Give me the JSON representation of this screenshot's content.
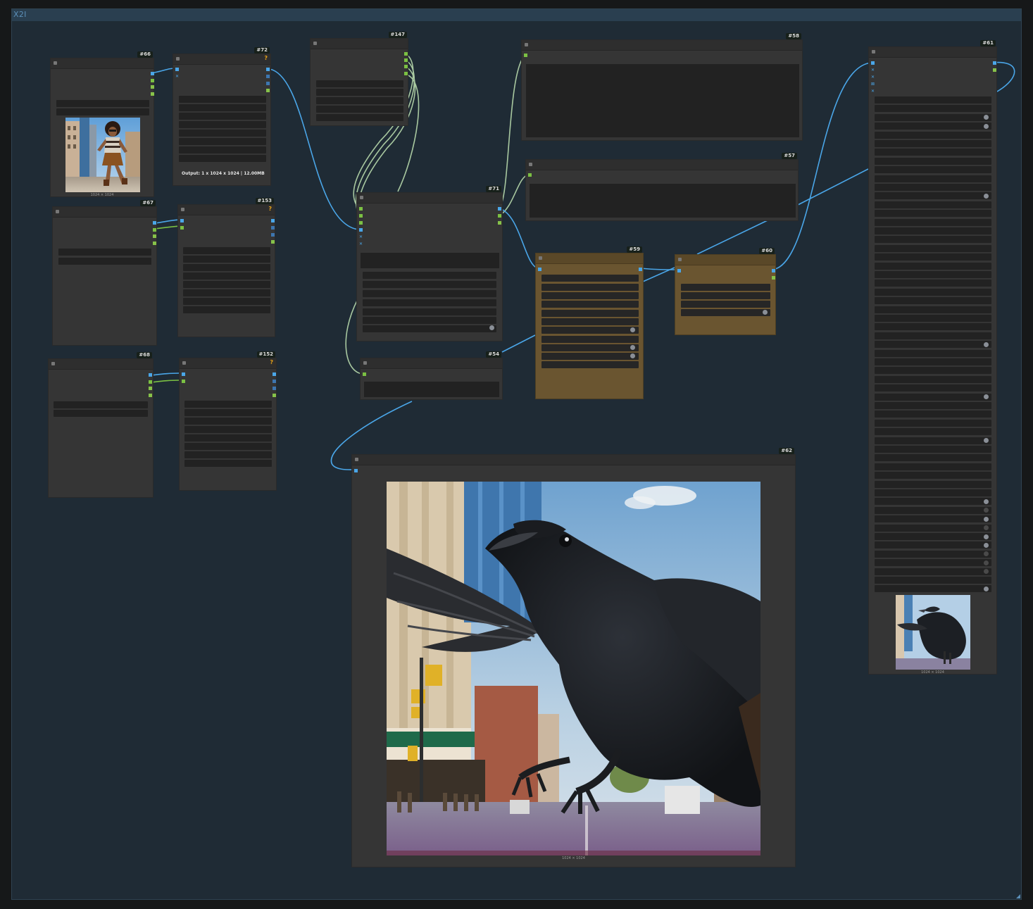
{
  "group": {
    "title": "X2I"
  },
  "nodes": {
    "n66": {
      "id": "#66",
      "image_size": "1024 × 1024"
    },
    "n72": {
      "id": "#72",
      "warning": "?",
      "output_text": "Output: 1 x 1024 x 1024 | 12.00MB"
    },
    "n147": {
      "id": "#147"
    },
    "n58": {
      "id": "#58"
    },
    "n57": {
      "id": "#57"
    },
    "n61": {
      "id": "#61",
      "image_size": "1024 × 1024"
    },
    "n67": {
      "id": "#67"
    },
    "n153": {
      "id": "#153",
      "warning": "?"
    },
    "n71": {
      "id": "#71"
    },
    "n59": {
      "id": "#59"
    },
    "n60": {
      "id": "#60"
    },
    "n68": {
      "id": "#68"
    },
    "n152": {
      "id": "#152",
      "warning": "?"
    },
    "n54": {
      "id": "#54"
    },
    "n62": {
      "id": "#62",
      "image_size": "1024 × 1024"
    }
  },
  "colors": {
    "canvas": "#161819",
    "group_bg": "#1f2b35",
    "node_bg": "#353535",
    "node_tan": "#6a5530",
    "link_image": "#4aa6e8",
    "link_conditioning": "#a8c8a0",
    "slot_green": "#7bc043"
  }
}
